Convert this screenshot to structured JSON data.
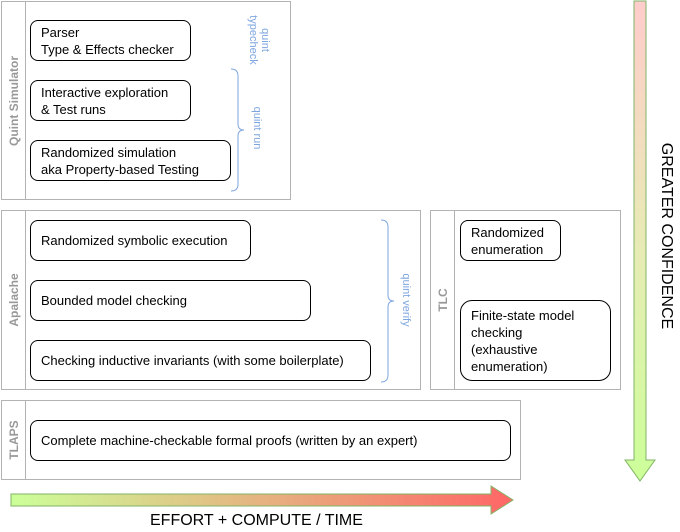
{
  "groups": {
    "quint_simulator": {
      "label": "Quint Simulator",
      "boxes": [
        {
          "text": "Parser\nType & Effects checker"
        },
        {
          "text": "Interactive exploration\n& Test runs"
        },
        {
          "text": "Randomized simulation\naka Property-based Testing"
        }
      ],
      "commands": [
        {
          "text": "quint\ntypecheck"
        },
        {
          "text": "quint run"
        }
      ]
    },
    "apalache": {
      "label": "Apalache",
      "boxes": [
        {
          "text": "Randomized symbolic execution"
        },
        {
          "text": "Bounded model checking"
        },
        {
          "text": "Checking inductive invariants (with some boilerplate)"
        }
      ],
      "commands": [
        {
          "text": "quint verify"
        }
      ]
    },
    "tlc": {
      "label": "TLC",
      "boxes": [
        {
          "text": "Randomized\nenumeration"
        },
        {
          "text": "Finite-state model\nchecking\n(exhaustive\nenumeration)"
        }
      ]
    },
    "tlaps": {
      "label": "TLAPS",
      "boxes": [
        {
          "text": "Complete machine-checkable formal proofs (written by an expert)"
        }
      ]
    }
  },
  "axes": {
    "horizontal_label": "EFFORT + COMPUTE / TIME",
    "vertical_label": "GREATER CONFIDENCE"
  },
  "colors": {
    "group_border": "#b3b3b3",
    "group_label": "#999999",
    "command": "#7ea6e0",
    "arrow_start": "#ccff99",
    "arrow_end": "#ff6666",
    "arrow_v_start": "#ffcccc",
    "arrow_stroke": "#82b366"
  }
}
